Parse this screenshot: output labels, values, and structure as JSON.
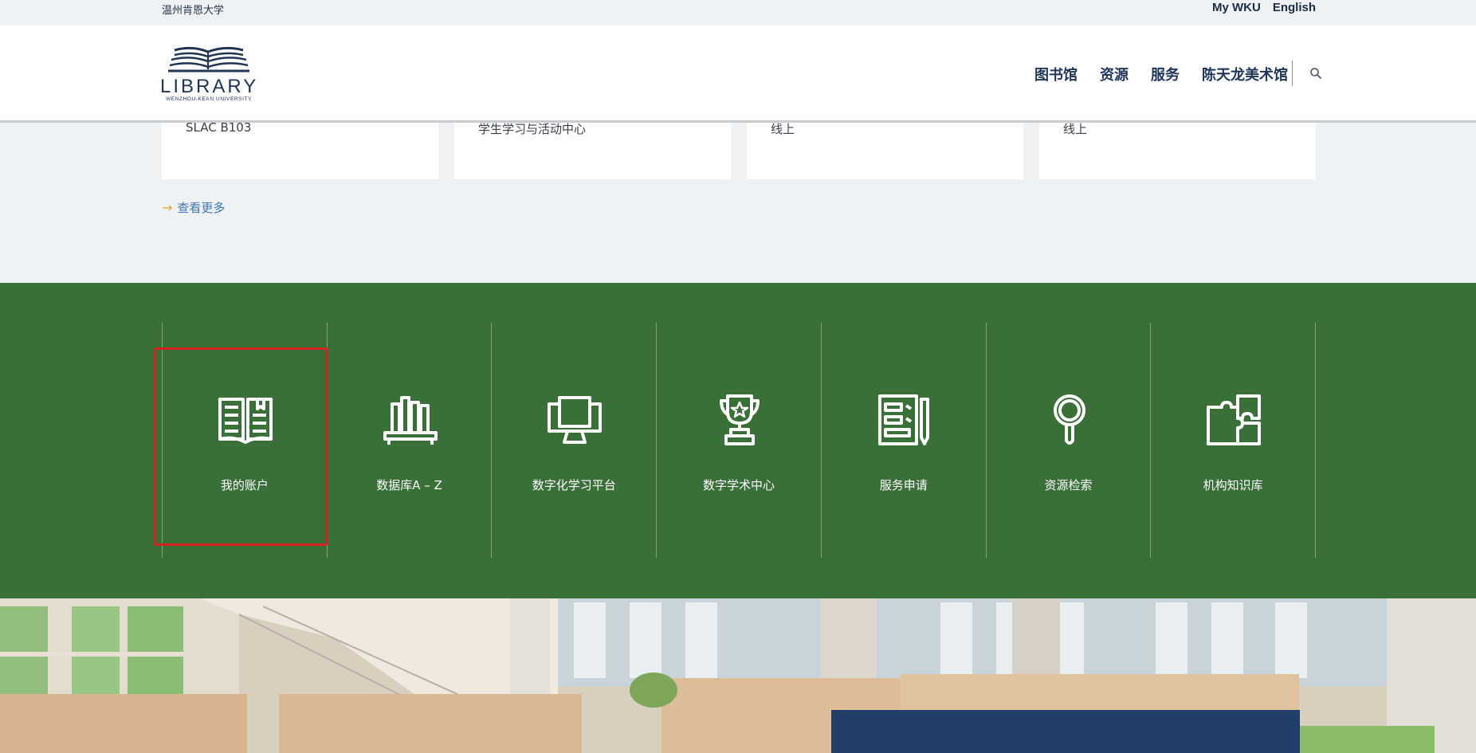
{
  "topbar": {
    "university": "温州肯恩大学",
    "my_wku": "My WKU",
    "language": "English"
  },
  "header": {
    "logo_text": "LIBRARY",
    "logo_sub": "WENZHOU-KEAN UNIVERSITY",
    "nav": [
      "图书馆",
      "资源",
      "服务",
      "陈天龙美术馆"
    ]
  },
  "events": {
    "locations": [
      "SLAC B103",
      "学生学习与活动中心",
      "线上",
      "线上"
    ],
    "more_label": "查看更多"
  },
  "quick_links": [
    {
      "label": "我的账户",
      "icon": "open-book-icon"
    },
    {
      "label": "数据库A – Z",
      "icon": "books-shelf-icon"
    },
    {
      "label": "数字化学习平台",
      "icon": "monitor-icon"
    },
    {
      "label": "数字学术中心",
      "icon": "trophy-icon"
    },
    {
      "label": "服务申请",
      "icon": "form-pencil-icon"
    },
    {
      "label": "资源检索",
      "icon": "magnifier-icon"
    },
    {
      "label": "机构知识库",
      "icon": "puzzle-icon"
    }
  ],
  "colors": {
    "green_band": "#387037",
    "nav_text": "#1d3556",
    "link": "#3b78b6",
    "arrow": "#e9a02f",
    "highlight": "#d42222",
    "banner_box": "#223e69"
  }
}
